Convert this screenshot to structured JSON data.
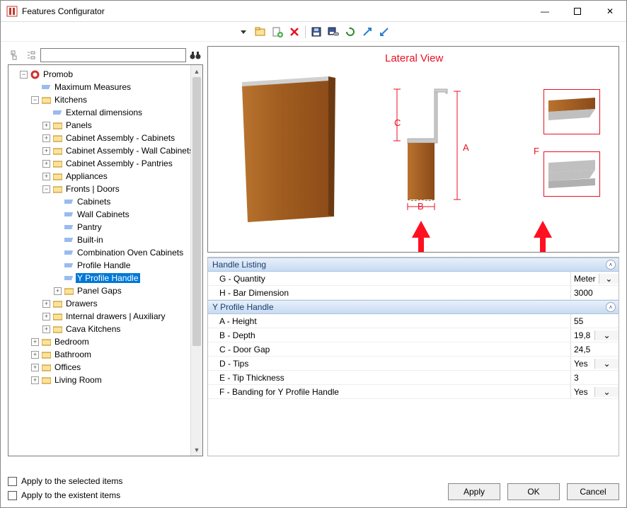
{
  "window": {
    "title": "Features Configurator",
    "min": "—",
    "max": "▢",
    "close": "✕"
  },
  "toolbar": {
    "items": [
      "dropdown",
      "paste",
      "insert",
      "delete",
      "save",
      "dbsave",
      "refresh",
      "expand-diag",
      "collapse-diag"
    ]
  },
  "tree_search": {
    "placeholder": ""
  },
  "tree": {
    "root": "Promob",
    "items": [
      "Maximum Measures",
      "Kitchens",
      "External dimensions",
      "Panels",
      "Cabinet Assembly - Cabinets",
      "Cabinet Assembly - Wall Cabinets",
      "Cabinet Assembly - Pantries",
      "Appliances",
      "Fronts | Doors",
      "Cabinets",
      "Wall Cabinets",
      "Pantry",
      "Built-in",
      "Combination Oven Cabinets",
      "Profile Handle",
      "Y Profile Handle",
      "Panel Gaps",
      "Drawers",
      "Internal drawers | Auxiliary",
      "Cava Kitchens",
      "Bedroom",
      "Bathroom",
      "Offices",
      "Living Room"
    ]
  },
  "preview": {
    "title": "Lateral View",
    "labels": {
      "A": "A",
      "B": "B",
      "C": "C",
      "F": "F"
    }
  },
  "sections": {
    "handle_listing": {
      "title": "Handle Listing",
      "rows": [
        {
          "name": "G - Quantity",
          "value": "Meter",
          "type": "combo"
        },
        {
          "name": "H - Bar Dimension",
          "value": "3000",
          "type": "text"
        }
      ]
    },
    "y_profile": {
      "title": "Y Profile Handle",
      "rows": [
        {
          "name": "A - Height",
          "value": "55",
          "type": "text"
        },
        {
          "name": "B - Depth",
          "value": "19,8",
          "type": "combo"
        },
        {
          "name": "C - Door Gap",
          "value": "24,5",
          "type": "text"
        },
        {
          "name": "D - Tips",
          "value": "Yes",
          "type": "combo"
        },
        {
          "name": "E - Tip Thickness",
          "value": "3",
          "type": "text"
        },
        {
          "name": "F - Banding for Y Profile Handle",
          "value": "Yes",
          "type": "combo"
        }
      ]
    }
  },
  "footer": {
    "apply_selected": "Apply to the selected items",
    "apply_existent": "Apply to the existent items",
    "apply_btn": "Apply",
    "ok_btn": "OK",
    "cancel_btn": "Cancel"
  }
}
